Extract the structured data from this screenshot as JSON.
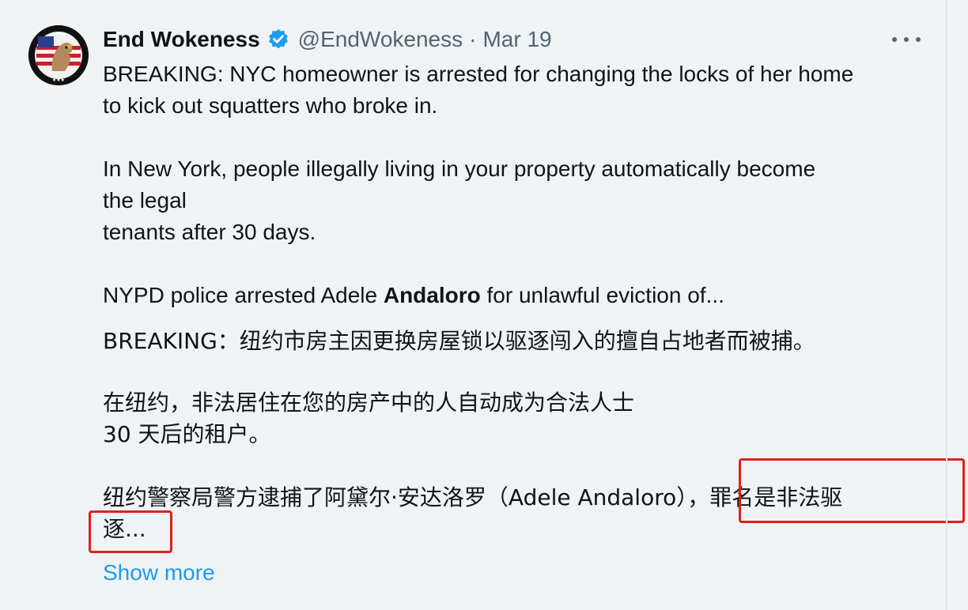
{
  "tweet": {
    "author": {
      "display_name": "End Wokeness",
      "handle": "@EndWokeness",
      "verified_icon": "verified-badge-icon",
      "avatar_icon": "avatar-eagle-flag"
    },
    "separator": "·",
    "date": "Mar 19",
    "more_icon": "more-horizontal-icon",
    "english": {
      "line1": "BREAKING: NYC homeowner is arrested for changing the locks of her home",
      "line2": "to kick out squatters who broke in.",
      "line3": "In New York, people illegally living in your property automatically become",
      "line4": "the legal",
      "line5": "tenants after 30 days.",
      "line6_pre": "NYPD police arrested Adele ",
      "line6_bold": "Andaloro",
      "line6_post": " for unlawful eviction of..."
    },
    "chinese": {
      "line1": "BREAKING：纽约市房主因更换房屋锁以驱逐闯入的擅自占地者而被捕。",
      "line2": "在纽约，非法居住在您的房产中的人自动成为合法人士",
      "line3": "30 天后的租户。",
      "line4": "纽约警察局警方逮捕了阿黛尔·安达洛罗（Adele Andaloro），罪名是非法驱",
      "line5": "逐..."
    },
    "show_more": "Show more",
    "highlight_color": "#e0201c",
    "link_color": "#1d9bf0"
  }
}
